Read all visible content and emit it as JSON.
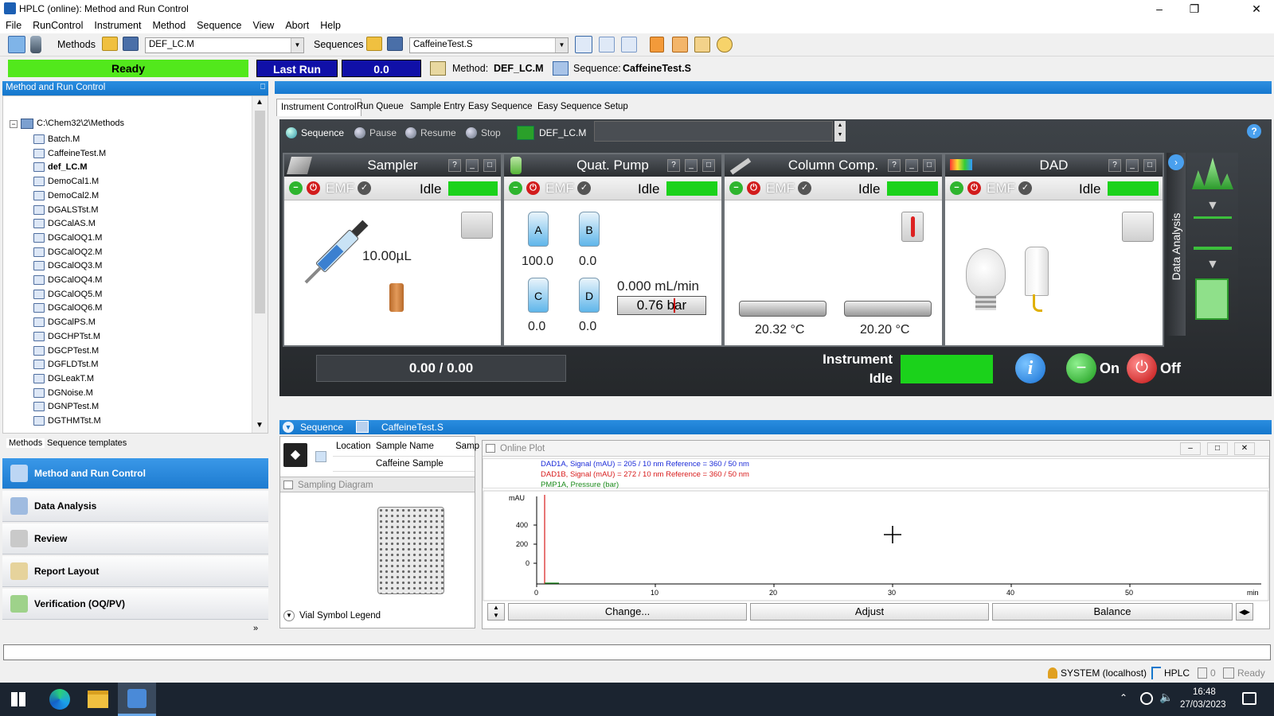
{
  "window": {
    "title": "HPLC (online): Method and Run Control"
  },
  "menu": [
    "File",
    "RunControl",
    "Instrument",
    "Method",
    "Sequence",
    "View",
    "Abort",
    "Help"
  ],
  "toolbar": {
    "methods_label": "Methods",
    "method_value": "DEF_LC.M",
    "sequences_label": "Sequences",
    "sequence_value": "CaffeineTest.S"
  },
  "status": {
    "ready": "Ready",
    "last_run_label": "Last Run",
    "last_run_value": "0.0",
    "method_label": "Method:",
    "method_name": "DEF_LC.M",
    "sequence_label": "Sequence:",
    "sequence_name": "CaffeineTest.S"
  },
  "left_panel": {
    "title": "Method and Run Control",
    "root": "C:\\Chem32\\2\\Methods",
    "items": [
      "Batch.M",
      "CaffeineTest.M",
      "def_LC.M",
      "DemoCal1.M",
      "DemoCal2.M",
      "DGALSTst.M",
      "DGCalAS.M",
      "DGCalOQ1.M",
      "DGCalOQ2.M",
      "DGCalOQ3.M",
      "DGCalOQ4.M",
      "DGCalOQ5.M",
      "DGCalOQ6.M",
      "DGCalPS.M",
      "DGCHPTst.M",
      "DGCPTest.M",
      "DGFLDTst.M",
      "DGLeakT.M",
      "DGNoise.M",
      "DGNPTest.M",
      "DGTHMTst.M"
    ],
    "selected": "def_LC.M",
    "bottom_tabs": [
      "Methods",
      "Sequence templates"
    ],
    "nav": [
      "Method and Run Control",
      "Data Analysis",
      "Review",
      "Report Layout",
      "Verification (OQ/PV)"
    ]
  },
  "tabs": [
    "Instrument Control",
    "Run Queue",
    "Sample Entry",
    "Easy Sequence",
    "Easy Sequence Setup"
  ],
  "instrument": {
    "toolbar": {
      "sequence": "Sequence",
      "pause": "Pause",
      "resume": "Resume",
      "stop": "Stop",
      "method": "DEF_LC.M"
    },
    "sampler": {
      "title": "Sampler",
      "emf": "EMF",
      "status": "Idle",
      "volume": "10.00µL"
    },
    "pump": {
      "title": "Quat. Pump",
      "emf": "EMF",
      "status": "Idle",
      "a_label": "A",
      "a": "100.0",
      "b_label": "B",
      "b": "0.0",
      "c_label": "C",
      "c": "0.0",
      "d_label": "D",
      "d": "0.0",
      "flow": "0.000 mL/min",
      "pressure": "0.76 bar"
    },
    "column": {
      "title": "Column Comp.",
      "emf": "EMF",
      "status": "Idle",
      "left_temp": "20.32 °C",
      "right_temp": "20.20 °C"
    },
    "dad": {
      "title": "DAD",
      "emf": "EMF",
      "status": "Idle"
    },
    "side_label": "Data Analysis",
    "progress": "0.00 / 0.00",
    "instrument_label": "Instrument",
    "instrument_status": "Idle",
    "on_label": "On",
    "off_label": "Off"
  },
  "sequence_panel": {
    "label": "Sequence",
    "name": "CaffeineTest.S",
    "col_location": "Location",
    "col_sample": "Sample Name",
    "col_samp": "Samp",
    "row_sample": "Caffeine Sample",
    "sampling_diagram": "Sampling Diagram",
    "legend": "Vial Symbol Legend"
  },
  "online_plot": {
    "title": "Online Plot",
    "legend": [
      "DAD1A, Signal (mAU) = 205 / 10 nm Reference = 360 / 50 nm",
      "DAD1B, Signal (mAU) = 272 / 10 nm Reference = 360 / 50 nm",
      "PMP1A, Pressure (bar)"
    ],
    "legend_colors": [
      "#1a2ad8",
      "#d81a1a",
      "#1a8a1a"
    ],
    "y_unit": "mAU",
    "y_ticks": [
      "400",
      "200",
      "0"
    ],
    "x_ticks": [
      "0",
      "10",
      "20",
      "30",
      "40",
      "50"
    ],
    "x_unit": "min",
    "buttons": {
      "change": "Change...",
      "adjust": "Adjust",
      "balance": "Balance"
    }
  },
  "statusbar": {
    "user": "SYSTEM (localhost)",
    "instrument": "HPLC",
    "count": "0",
    "state": "Ready"
  },
  "taskbar": {
    "time": "16:48",
    "date": "27/03/2023"
  }
}
